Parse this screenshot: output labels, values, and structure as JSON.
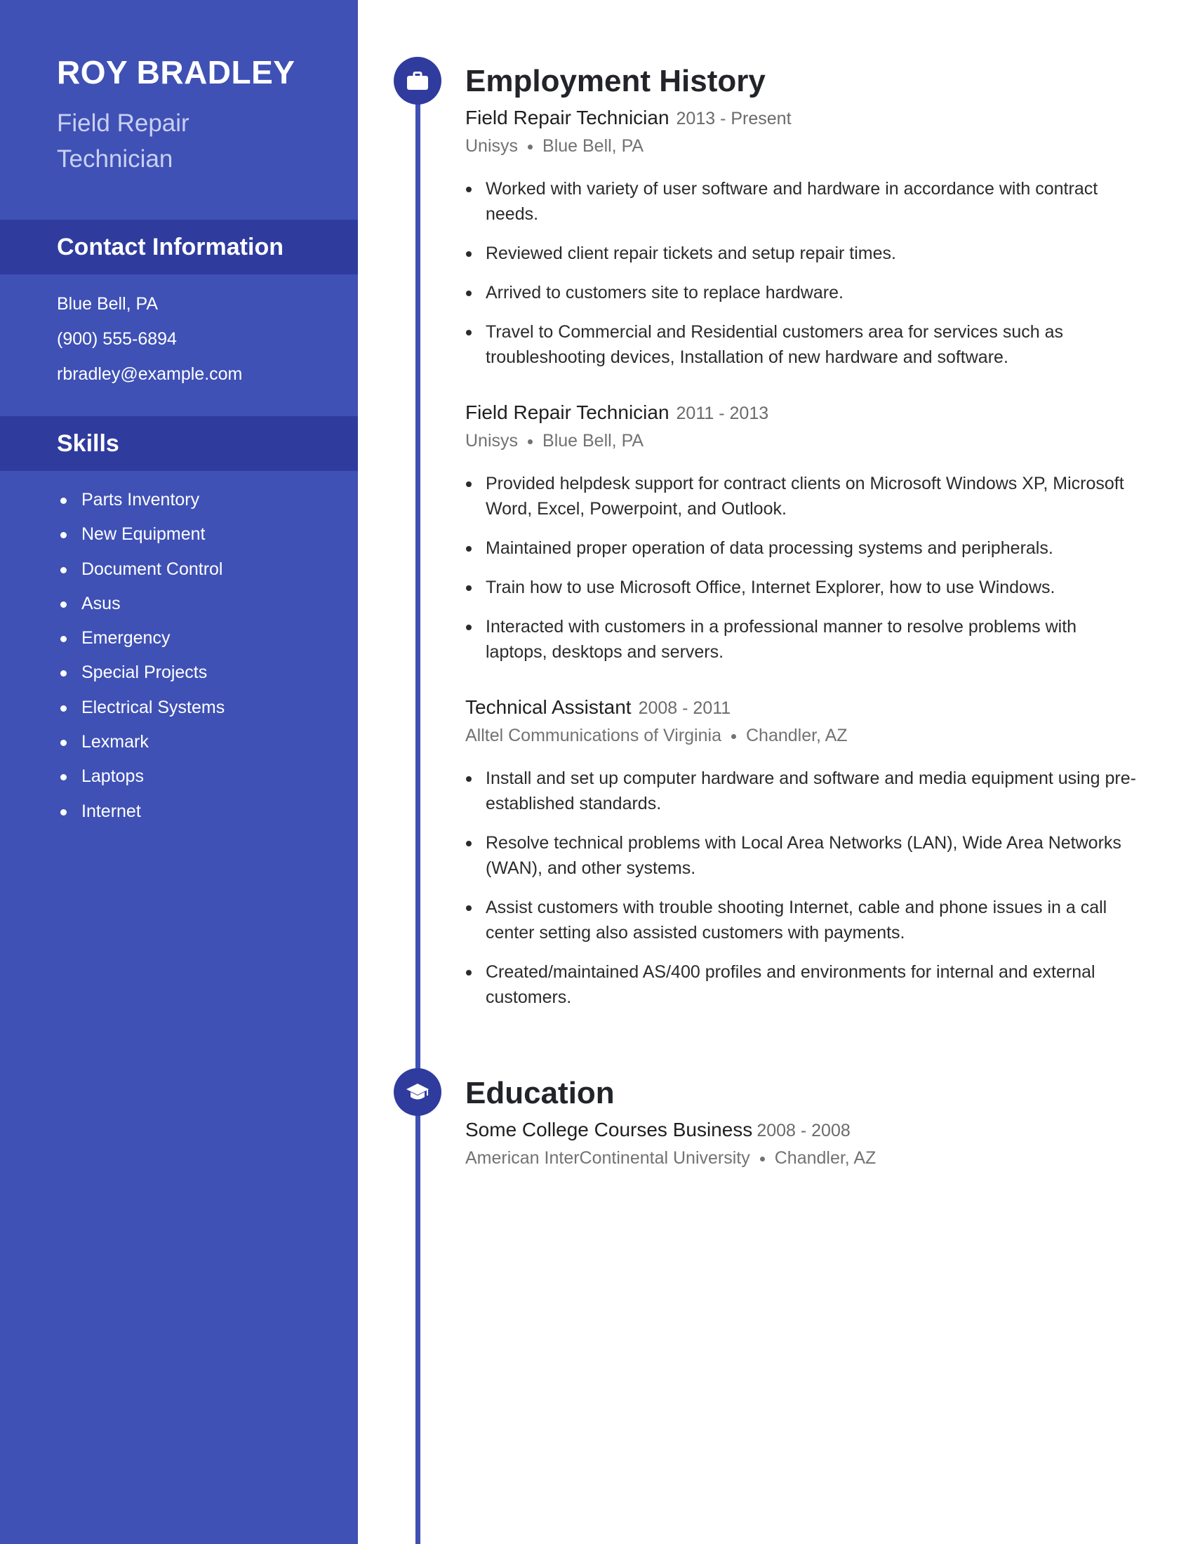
{
  "colors": {
    "sidebar": "#3f51b5",
    "sidebar_band": "#2f3c9e",
    "accent": "#3f51b5",
    "text_dark": "#232429",
    "text_muted": "#727272"
  },
  "profile": {
    "name": "ROY BRADLEY",
    "headline": "Field Repair Technician"
  },
  "contact": {
    "heading": "Contact Information",
    "items": [
      "Blue Bell, PA",
      "(900) 555-6894",
      "rbradley@example.com"
    ]
  },
  "skills": {
    "heading": "Skills",
    "items": [
      "Parts Inventory",
      "New Equipment",
      "Document Control",
      "Asus",
      "Emergency",
      "Special Projects",
      "Electrical Systems",
      "Lexmark",
      "Laptops",
      "Internet"
    ]
  },
  "employment": {
    "heading": "Employment History",
    "icon": "briefcase-icon",
    "jobs": [
      {
        "title": "Field Repair Technician",
        "dates": "2013 - Present",
        "company": "Unisys",
        "location": "Blue Bell, PA",
        "bullets": [
          "Worked with variety of user software and hardware in accordance with contract needs.",
          "Reviewed client repair tickets and setup repair times.",
          "Arrived to customers site to replace hardware.",
          "Travel to Commercial and Residential customers area for services such as troubleshooting devices, Installation of new hardware and software."
        ]
      },
      {
        "title": "Field Repair Technician",
        "dates": "2011 - 2013",
        "company": "Unisys",
        "location": "Blue Bell, PA",
        "bullets": [
          "Provided helpdesk support for contract clients on Microsoft Windows XP, Microsoft Word, Excel, Powerpoint, and Outlook.",
          "Maintained proper operation of data processing systems and peripherals.",
          "Train how to use Microsoft Office, Internet Explorer, how to use Windows.",
          "Interacted with customers in a professional manner to resolve problems with laptops, desktops and servers."
        ]
      },
      {
        "title": "Technical Assistant",
        "dates": "2008 - 2011",
        "company": "Alltel Communications of Virginia",
        "location": "Chandler, AZ",
        "bullets": [
          "Install and set up computer hardware and software and media equipment using pre-established standards.",
          "Resolve technical problems with Local Area Networks (LAN), Wide Area Networks (WAN), and other systems.",
          "Assist customers with trouble shooting Internet, cable and phone issues in a call center setting also assisted customers with payments.",
          "Created/maintained AS/400 profiles and environments for internal and external customers."
        ]
      }
    ]
  },
  "education": {
    "heading": "Education",
    "icon": "graduation-cap-icon",
    "entries": [
      {
        "title": "Some College Courses Business",
        "dates": "2008 - 2008",
        "school": "American InterContinental University",
        "location": "Chandler, AZ"
      }
    ]
  }
}
